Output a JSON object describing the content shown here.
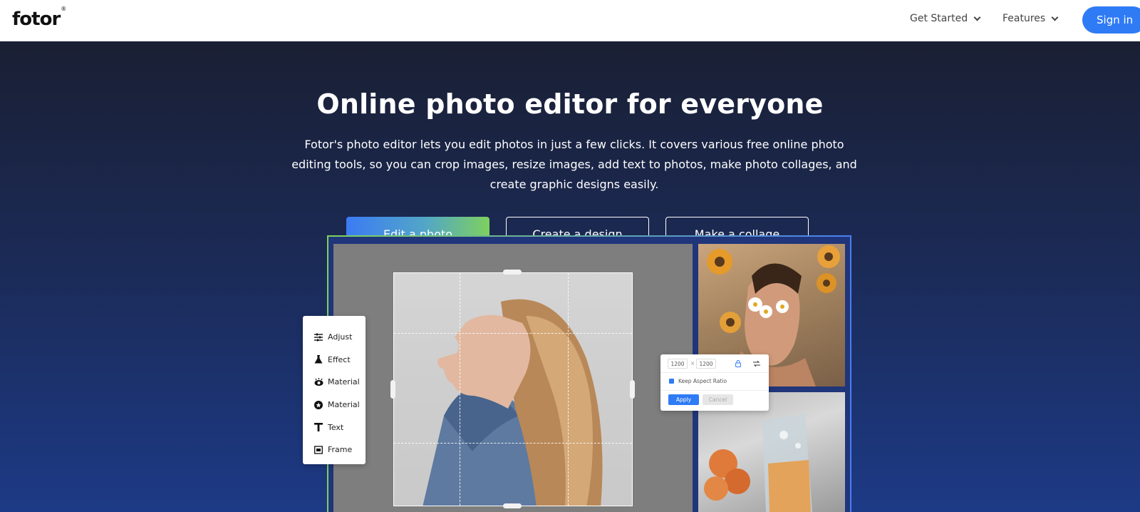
{
  "header": {
    "logo": "fotor",
    "logo_mark": "®",
    "nav": [
      {
        "label": "Get Started"
      },
      {
        "label": "Features"
      }
    ],
    "signin_label": "Sign in"
  },
  "hero": {
    "title": "Online photo editor for everyone",
    "description": "Fotor's photo editor lets you edit photos in just a few clicks. It covers various free online photo editing tools, so you can crop images, resize images, add text to photos, make photo collages, and create graphic designs easily.",
    "buttons": {
      "edit": "Edit a photo",
      "design": "Create a design",
      "collage": "Make a collage"
    }
  },
  "editor": {
    "tools": [
      {
        "label": "Adjust",
        "icon": "sliders-icon"
      },
      {
        "label": "Effect",
        "icon": "flask-icon"
      },
      {
        "label": "Material",
        "icon": "eye-icon"
      },
      {
        "label": "Material",
        "icon": "circle-badge-icon"
      },
      {
        "label": "Text",
        "icon": "text-icon"
      },
      {
        "label": "Frame",
        "icon": "frame-icon"
      }
    ],
    "resize": {
      "width": "1200",
      "separator": "×",
      "height": "1200",
      "keep_aspect": "Keep Aspect Ratio",
      "apply": "Apply",
      "cancel": "Cancel"
    }
  },
  "colors": {
    "accent": "#2f7bf5",
    "gradient_start": "#3c7bf4",
    "gradient_end": "#7ed15e"
  }
}
